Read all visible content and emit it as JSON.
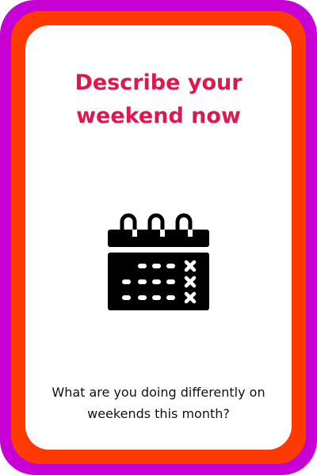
{
  "card": {
    "title": "Describe your weekend now",
    "prompt": "What are you doing differently on weekends this month?",
    "icon": "calendar-icon"
  },
  "colors": {
    "outer_border": "#c700d6",
    "inner_border": "#ff3a00",
    "title": "#e0174d",
    "text": "#111111",
    "icon": "#000000",
    "background": "#ffffff"
  }
}
